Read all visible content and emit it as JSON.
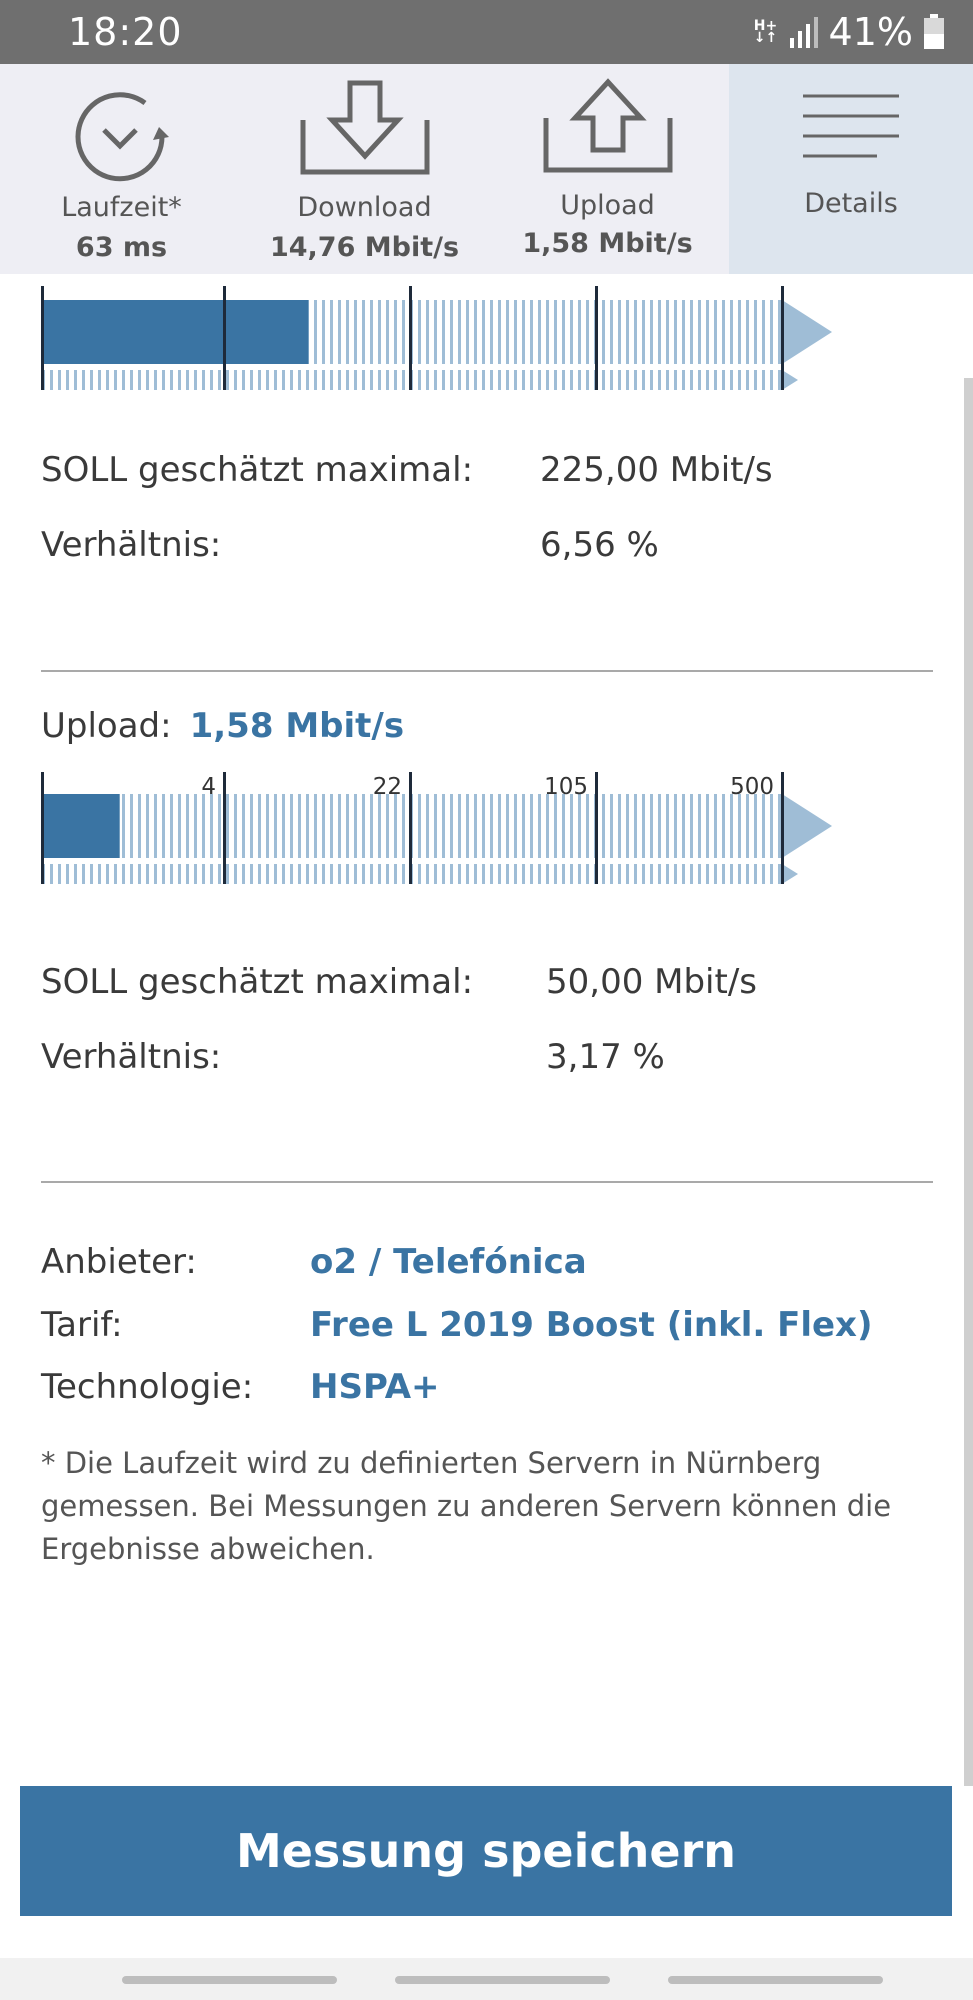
{
  "status": {
    "time": "18:20",
    "network": "H+",
    "battery": "41%",
    "icons": [
      "network-type-icon",
      "signal-icon",
      "battery-icon"
    ]
  },
  "tabs": [
    {
      "label": "Laufzeit*",
      "value": "63 ms",
      "icon": "clock-refresh-icon"
    },
    {
      "label": "Download",
      "value": "14,76 Mbit/s",
      "icon": "download-tray-icon"
    },
    {
      "label": "Upload",
      "value": "1,58 Mbit/s",
      "icon": "upload-tray-icon"
    },
    {
      "label": "Details",
      "value": "",
      "icon": "list-lines-icon",
      "active": true
    }
  ],
  "download": {
    "fill_fraction": 0.36,
    "soll_label": "SOLL geschätzt maximal:",
    "soll_value": "225,00 Mbit/s",
    "ratio_label": "Verhältnis:",
    "ratio_value": "6,56 %"
  },
  "upload": {
    "label": "Upload:",
    "value": "1,58 Mbit/s",
    "scale_ticks": [
      "4",
      "22",
      "105",
      "500"
    ],
    "fill_fraction": 0.105,
    "soll_label": "SOLL geschätzt maximal:",
    "soll_value": "50,00 Mbit/s",
    "ratio_label": "Verhältnis:",
    "ratio_value": "3,17 %"
  },
  "provider": {
    "provider_label": "Anbieter:",
    "provider_value": "o2 / Telefónica",
    "tariff_label": "Tarif:",
    "tariff_value": "Free L 2019 Boost (inkl. Flex)",
    "tech_label": "Technologie:",
    "tech_value": "HSPA+"
  },
  "footnote": "* Die Laufzeit wird zu definierten Servern in Nürnberg gemessen. Bei Messungen zu anderen Servern können die Ergebnisse abweichen.",
  "save_button": "Messung speichern",
  "colors": {
    "accent": "#3a74a3",
    "bar_light": "#9fbdd6",
    "status_bar": "#6f6f6f",
    "tab_bg": "#eeeef4",
    "tab_active": "#dde5ee"
  }
}
